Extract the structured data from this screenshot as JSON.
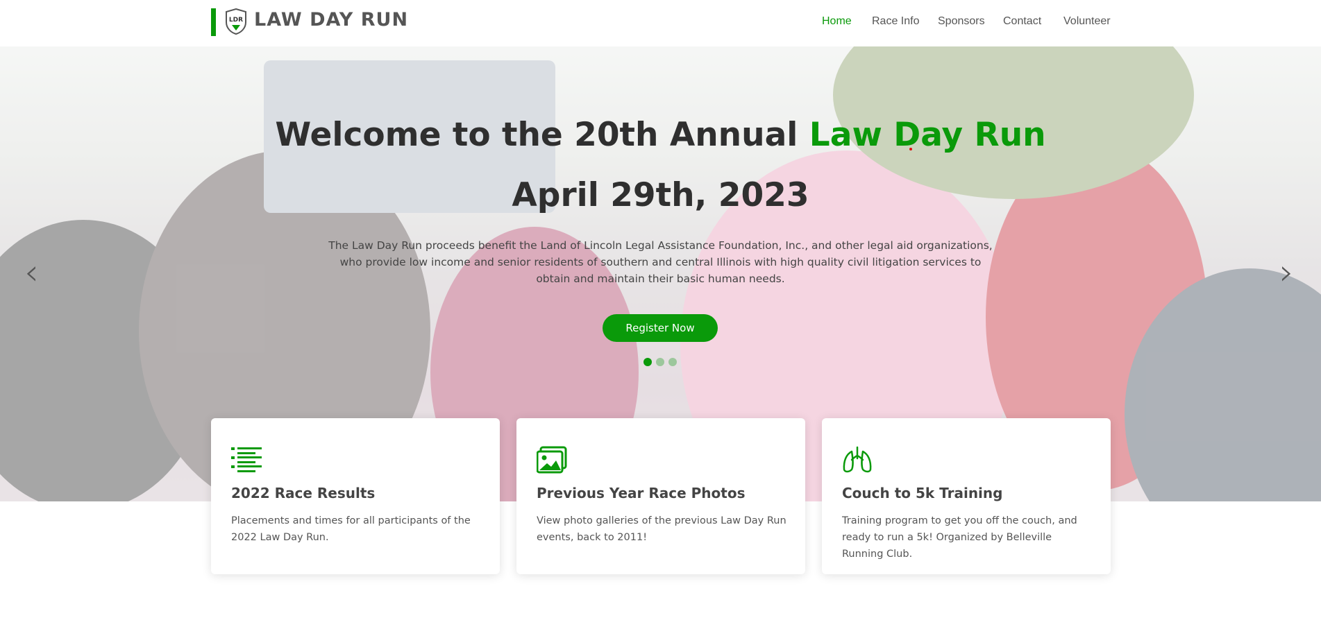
{
  "colors": {
    "accent": "#0a9a0a",
    "text_dark": "#2f2f2f",
    "nav_text": "#555555"
  },
  "brand": {
    "name": "LAW DAY RUN",
    "badge_text": "LDR"
  },
  "nav": {
    "items": [
      {
        "label": "Home",
        "active": true
      },
      {
        "label": "Race Info",
        "active": false
      },
      {
        "label": "Sponsors",
        "active": false
      },
      {
        "label": "Contact",
        "active": false
      },
      {
        "label": "Volunteer",
        "active": false
      }
    ]
  },
  "hero": {
    "title_prefix": "Welcome to the 20th Annual ",
    "title_highlight": "Law Day Run",
    "date": "April 29th, 2023",
    "description": "The Law Day Run proceeds benefit the Land of Lincoln Legal Assistance Foundation, Inc., and other legal aid organizations, who provide low income and senior residents of southern and central Illinois with high quality civil litigation services to obtain and maintain their basic human needs.",
    "cta_label": "Register Now",
    "carousel": {
      "slide_count": 3,
      "active_slide": 1
    },
    "prev_icon": "chevron-left-icon",
    "next_icon": "chevron-right-icon"
  },
  "cards": [
    {
      "icon": "list-icon",
      "title": "2022 Race Results",
      "description": "Placements and times for all participants of the 2022 Law Day Run."
    },
    {
      "icon": "image-icon",
      "title": "Previous Year Race Photos",
      "description": "View photo galleries of the previous Law Day Run events, back to 2011!"
    },
    {
      "icon": "lungs-icon",
      "title": "Couch to 5k Training",
      "description": "Training program to get you off the couch, and ready to run a 5k! Organized by Belleville Running Club."
    }
  ]
}
